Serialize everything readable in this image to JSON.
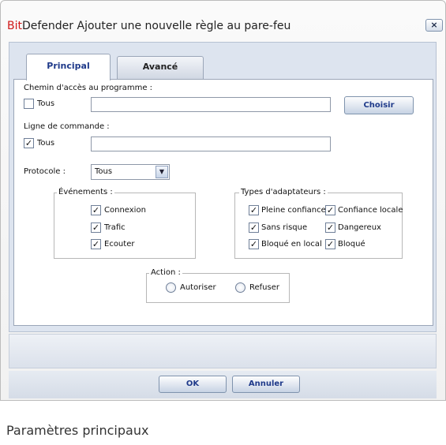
{
  "title": {
    "brand": "Bit",
    "brand_rest": "Defender",
    "text": "Ajouter une nouvelle règle au pare-feu",
    "close": "×"
  },
  "tabs": [
    {
      "label": "Principal"
    },
    {
      "label": "Avancé"
    }
  ],
  "program_path": {
    "label": "Chemin d'accès au programme :",
    "all_checked": false,
    "all_label": "Tous",
    "value": "",
    "browse_label": "Choisir"
  },
  "command_line": {
    "label": "Ligne de commande :",
    "all_checked": true,
    "all_label": "Tous",
    "value": ""
  },
  "protocol": {
    "label": "Protocole :",
    "value": "Tous"
  },
  "events": {
    "legend": "Événements :",
    "items": [
      {
        "label": "Connexion",
        "checked": true
      },
      {
        "label": "Trafic",
        "checked": true
      },
      {
        "label": "Ecouter",
        "checked": true
      }
    ]
  },
  "adapters": {
    "legend": "Types d'adaptateurs :",
    "items": [
      {
        "label": "Pleine confiance",
        "checked": true
      },
      {
        "label": "Confiance locale",
        "checked": true
      },
      {
        "label": "Sans risque",
        "checked": true
      },
      {
        "label": "Dangereux",
        "checked": true
      },
      {
        "label": "Bloqué en local",
        "checked": true
      },
      {
        "label": "Bloqué",
        "checked": true
      }
    ]
  },
  "action": {
    "legend": "Action :",
    "allow_label": "Autoriser",
    "deny_label": "Refuser"
  },
  "buttons": {
    "ok": "OK",
    "cancel": "Annuler"
  },
  "caption": "Paramètres principaux"
}
